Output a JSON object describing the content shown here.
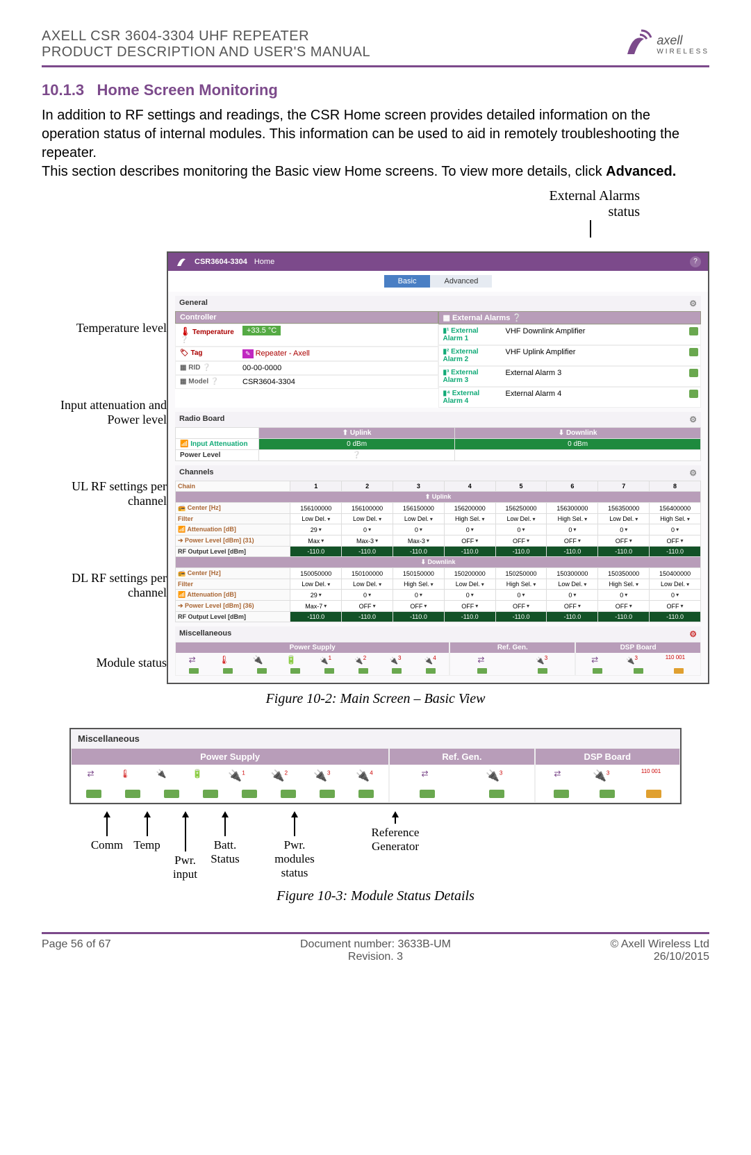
{
  "doc": {
    "headerLine1": "AXELL CSR 3604-3304 UHF REPEATER",
    "headerLine2": "PRODUCT DESCRIPTION AND USER'S MANUAL",
    "logoBrand": "axell",
    "logoSub": "WIRELESS",
    "sectionNum": "10.1.3",
    "sectionTitle": "Home Screen Monitoring",
    "para1": "In addition to RF settings and readings, the CSR Home screen provides detailed information on the operation status of internal modules. This information can be used to aid in remotely troubleshooting the repeater.",
    "para2a": "This section describes monitoring the Basic view Home screens. To view more details, click ",
    "para2b": "Advanced.",
    "extAlarmsLabel1": "External Alarms",
    "extAlarmsLabel2": "status",
    "callout_temp": "Temperature level",
    "callout_input": "Input attenuation and Power level",
    "callout_ul": "UL RF settings per channel",
    "callout_dl": "DL RF settings per channel",
    "callout_mod": "Module status",
    "fig1": "Figure 10-2: Main Screen – Basic View",
    "fig2": "Figure 10-3: Module Status Details",
    "arr_comm": "Comm",
    "arr_temp": "Temp",
    "arr_pwrin1": "Pwr.",
    "arr_pwrin2": "input",
    "arr_batt1": "Batt.",
    "arr_batt2": "Status",
    "arr_pmod1": "Pwr.",
    "arr_pmod2": "modules",
    "arr_pmod3": "status",
    "arr_ref1": "Reference",
    "arr_ref2": "Generator",
    "footerL": "Page 56 of 67",
    "footerC1": "Document number: 3633B-UM",
    "footerC2": "Revision. 3",
    "footerR1": "© Axell Wireless Ltd",
    "footerR2": "26/10/2015"
  },
  "app": {
    "model": "CSR3604-3304",
    "crumb": "Home",
    "help": "?",
    "tab_basic": "Basic",
    "tab_advanced": "Advanced",
    "general": {
      "title": "General",
      "controllerHdr": "Controller",
      "extAlarmsHdr": "External Alarms",
      "tempLabel": "Temperature",
      "tempVal": "+33.5 °C",
      "tagLabel": "Tag",
      "tagVal": "Repeater - Axell",
      "ridLabel": "RID",
      "ridVal": "00-00-0000",
      "modelLabel": "Model",
      "modelVal": "CSR3604-3304",
      "ea1": "External Alarm 1",
      "ea1v": "VHF Downlink Amplifier",
      "ea2": "External Alarm 2",
      "ea2v": "VHF Uplink Amplifier",
      "ea3": "External Alarm 3",
      "ea3v": "External Alarm 3",
      "ea4": "External Alarm 4",
      "ea4v": "External Alarm 4"
    },
    "radio": {
      "title": "Radio Board",
      "uplink": "Uplink",
      "downlink": "Downlink",
      "inAtt": "Input Attenuation",
      "pwr": "Power Level",
      "val0": "0 dBm"
    },
    "channels": {
      "title": "Channels",
      "chain": "Chain",
      "nums": [
        "1",
        "2",
        "3",
        "4",
        "5",
        "6",
        "7",
        "8"
      ],
      "uplink": "Uplink",
      "downlink": "Downlink",
      "rows": {
        "center": "Center [Hz]",
        "filter": "Filter",
        "att": "Attenuation [dB]",
        "pwrlvl_ul": "Power Level [dBm] (31)",
        "pwrlvl_dl": "Power Level [dBm] (36)",
        "rfout": "RF Output Level [dBm]"
      },
      "ul_center": [
        "156100000",
        "156100000",
        "156150000",
        "156200000",
        "156250000",
        "156300000",
        "156350000",
        "156400000"
      ],
      "ul_filter": [
        "Low Del.",
        "Low Del.",
        "Low Del.",
        "High Sel.",
        "Low Del.",
        "High Sel.",
        "Low Del.",
        "High Sel."
      ],
      "ul_att": [
        "29",
        "0",
        "0",
        "0",
        "0",
        "0",
        "0",
        "0"
      ],
      "ul_pwr": [
        "Max",
        "Max-3",
        "Max-3",
        "OFF",
        "OFF",
        "OFF",
        "OFF",
        "OFF"
      ],
      "ul_rfout": [
        "-110.0",
        "-110.0",
        "-110.0",
        "-110.0",
        "-110.0",
        "-110.0",
        "-110.0",
        "-110.0"
      ],
      "dl_center": [
        "150050000",
        "150100000",
        "150150000",
        "150200000",
        "150250000",
        "150300000",
        "150350000",
        "150400000"
      ],
      "dl_filter": [
        "Low Del.",
        "Low Del.",
        "High Sel.",
        "Low Del.",
        "High Sel.",
        "Low Del.",
        "High Sel.",
        "Low Del."
      ],
      "dl_att": [
        "29",
        "0",
        "0",
        "0",
        "0",
        "0",
        "0",
        "0"
      ],
      "dl_pwr": [
        "Max-7",
        "OFF",
        "OFF",
        "OFF",
        "OFF",
        "OFF",
        "OFF",
        "OFF"
      ],
      "dl_rfout": [
        "-110.0",
        "-110.0",
        "-110.0",
        "-110.0",
        "-110.0",
        "-110.0",
        "-110.0",
        "-110.0"
      ]
    },
    "misc": {
      "title": "Miscellaneous",
      "power": "Power Supply",
      "ref": "Ref. Gen.",
      "dsp": "DSP Board",
      "sup": [
        "1",
        "2",
        "3",
        "4"
      ],
      "ref_sup": [
        "3"
      ],
      "bin": "110\n001"
    }
  }
}
